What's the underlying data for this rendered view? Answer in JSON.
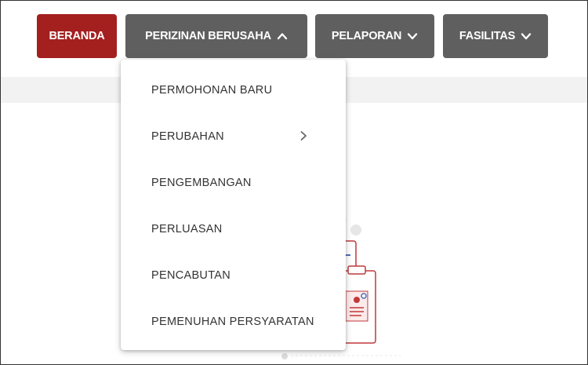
{
  "nav": {
    "home_label": "BERANDA",
    "perizinan_label": "PERIZINAN BERUSAHA",
    "pelaporan_label": "PELAPORAN",
    "fasilitas_label": "FASILITAS"
  },
  "dropdown": {
    "items": [
      {
        "label": "PERMOHONAN BARU"
      },
      {
        "label": "PERUBAHAN",
        "submenu_icon": "chevron-right-icon"
      },
      {
        "label": "PENGEMBANGAN"
      },
      {
        "label": "PERLUASAN"
      },
      {
        "label": "PENCABUTAN"
      },
      {
        "label": "PEMENUHAN PERSYARATAN"
      }
    ]
  },
  "icons": {
    "perizinan": "chevron-up-icon",
    "pelaporan": "chevron-down-icon",
    "fasilitas": "chevron-down-icon"
  },
  "colors": {
    "home_bg": "#a3201f",
    "nav_bg": "#5f5f5f",
    "band_bg": "#f2f2f2",
    "illustration_accent": "#c0393b"
  }
}
